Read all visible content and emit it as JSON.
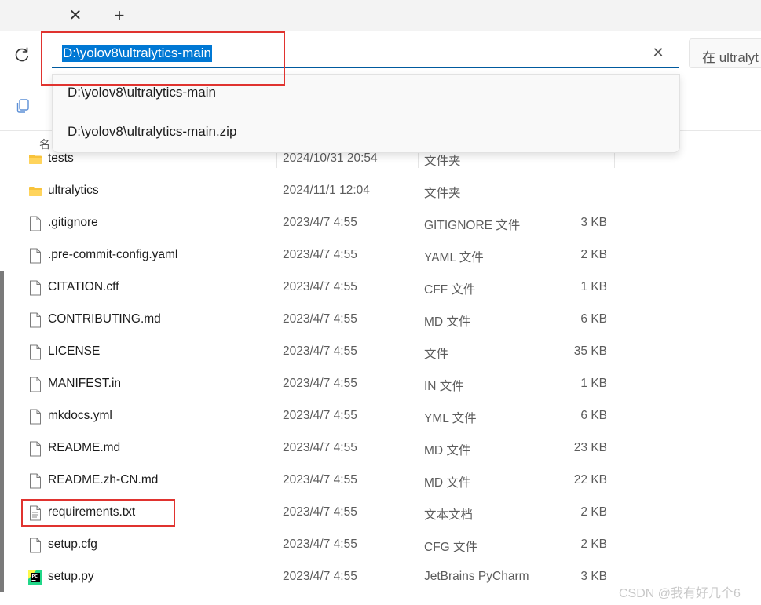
{
  "tabbar": {
    "close_glyph": "✕",
    "new_tab_glyph": "+"
  },
  "address_bar": {
    "path": "D:\\yolov8\\ultralytics-main",
    "clear_glyph": "✕",
    "search_placeholder": "在 ultralyt"
  },
  "suggestions": [
    {
      "label": "D:\\yolov8\\ultralytics-main"
    },
    {
      "label": "D:\\yolov8\\ultralytics-main.zip"
    }
  ],
  "columns": {
    "name_label_partial": "名"
  },
  "files": [
    {
      "name": "tests",
      "date": "2024/10/31 20:54",
      "type": "文件夹",
      "size": "",
      "icon": "folder-icon"
    },
    {
      "name": "ultralytics",
      "date": "2024/11/1 12:04",
      "type": "文件夹",
      "size": "",
      "icon": "folder-icon"
    },
    {
      "name": ".gitignore",
      "date": "2023/4/7 4:55",
      "type": "GITIGNORE 文件",
      "size": "3 KB",
      "icon": "file-icon"
    },
    {
      "name": ".pre-commit-config.yaml",
      "date": "2023/4/7 4:55",
      "type": "YAML 文件",
      "size": "2 KB",
      "icon": "file-icon"
    },
    {
      "name": "CITATION.cff",
      "date": "2023/4/7 4:55",
      "type": "CFF 文件",
      "size": "1 KB",
      "icon": "file-icon"
    },
    {
      "name": "CONTRIBUTING.md",
      "date": "2023/4/7 4:55",
      "type": "MD 文件",
      "size": "6 KB",
      "icon": "file-icon"
    },
    {
      "name": "LICENSE",
      "date": "2023/4/7 4:55",
      "type": "文件",
      "size": "35 KB",
      "icon": "file-icon"
    },
    {
      "name": "MANIFEST.in",
      "date": "2023/4/7 4:55",
      "type": "IN 文件",
      "size": "1 KB",
      "icon": "file-icon"
    },
    {
      "name": "mkdocs.yml",
      "date": "2023/4/7 4:55",
      "type": "YML 文件",
      "size": "6 KB",
      "icon": "file-icon"
    },
    {
      "name": "README.md",
      "date": "2023/4/7 4:55",
      "type": "MD 文件",
      "size": "23 KB",
      "icon": "file-icon"
    },
    {
      "name": "README.zh-CN.md",
      "date": "2023/4/7 4:55",
      "type": "MD 文件",
      "size": "22 KB",
      "icon": "file-icon"
    },
    {
      "name": "requirements.txt",
      "date": "2023/4/7 4:55",
      "type": "文本文档",
      "size": "2 KB",
      "icon": "text-document-icon"
    },
    {
      "name": "setup.cfg",
      "date": "2023/4/7 4:55",
      "type": "CFG 文件",
      "size": "2 KB",
      "icon": "file-icon"
    },
    {
      "name": "setup.py",
      "date": "2023/4/7 4:55",
      "type": "JetBrains PyCharm",
      "size": "3 KB",
      "icon": "pycharm-icon"
    }
  ],
  "watermark": "CSDN @我有好几个6",
  "colors": {
    "accent": "#0078d4",
    "folder": "#f8c33b",
    "highlight_box": "#e0332f"
  }
}
